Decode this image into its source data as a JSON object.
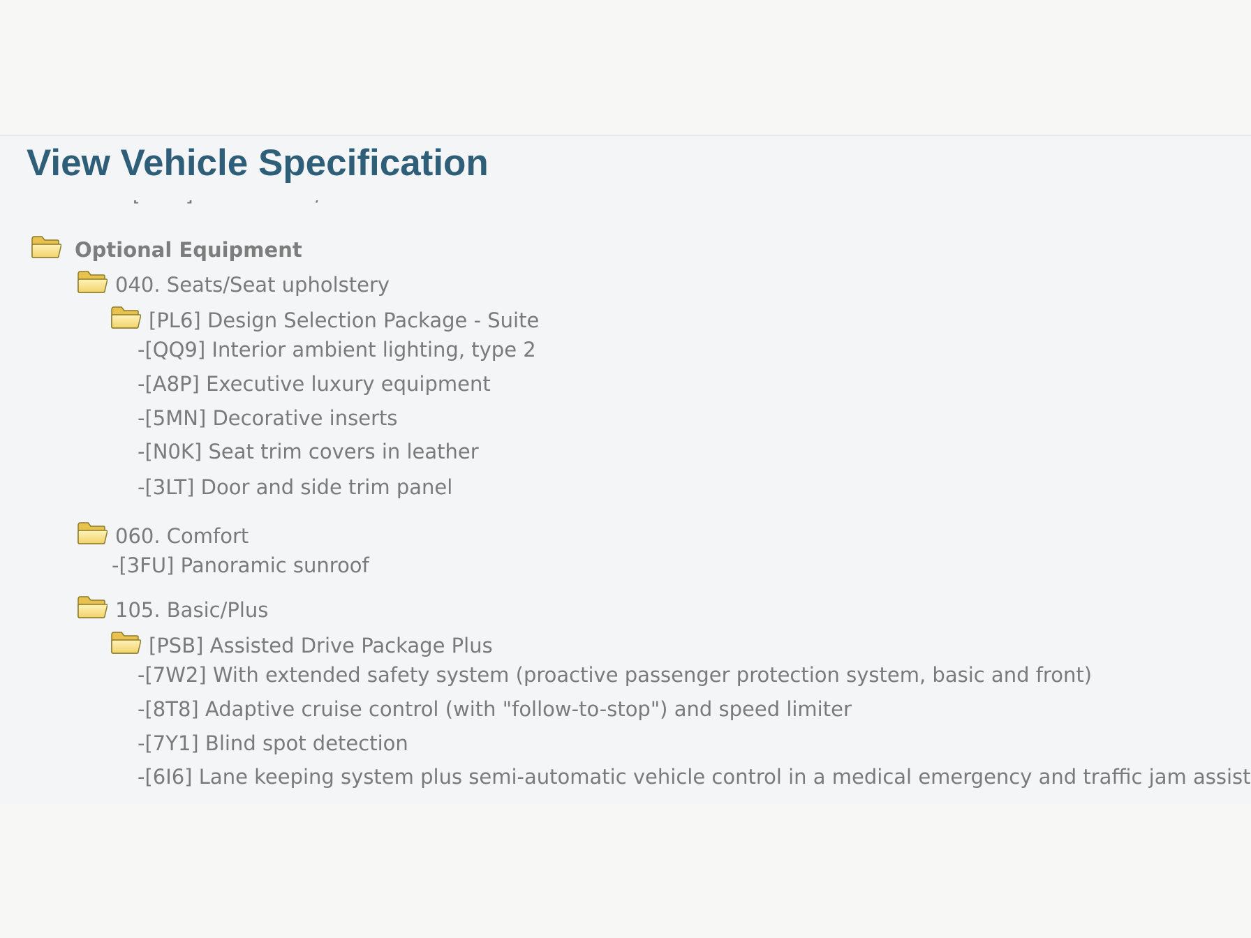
{
  "page": {
    "title": "View Vehicle Specification"
  },
  "tree": {
    "partial_line": "- [ · · · ] · · · · · · · · · /",
    "section_label": "Optional Equipment",
    "seats": {
      "label": "040. Seats/Seat upholstery",
      "package_label": "[PL6] Design Selection Package - Suite",
      "items": [
        "-[QQ9] Interior ambient lighting, type 2",
        "-[A8P] Executive luxury equipment",
        "-[5MN] Decorative inserts",
        "-[N0K] Seat trim covers in leather",
        "-[3LT] Door and side trim panel"
      ]
    },
    "comfort": {
      "label": "060. Comfort",
      "items": [
        "-[3FU] Panoramic sunroof"
      ]
    },
    "basic": {
      "label": "105. Basic/Plus",
      "package_label": "[PSB] Assisted Drive Package Plus",
      "items": [
        "-[7W2] With extended safety system (proactive passenger protection system, basic and front)",
        "-[8T8] Adaptive cruise control (with \"follow-to-stop\") and speed limiter",
        "-[7Y1] Blind spot detection",
        "-[6I6] Lane keeping system plus semi-automatic vehicle control in a medical emergency and traffic jam assist"
      ]
    }
  },
  "colors": {
    "title": "#2f5e78",
    "text": "#7a7a7a",
    "folder_fill": "#f2d36b",
    "folder_stroke": "#8a7a2a"
  }
}
